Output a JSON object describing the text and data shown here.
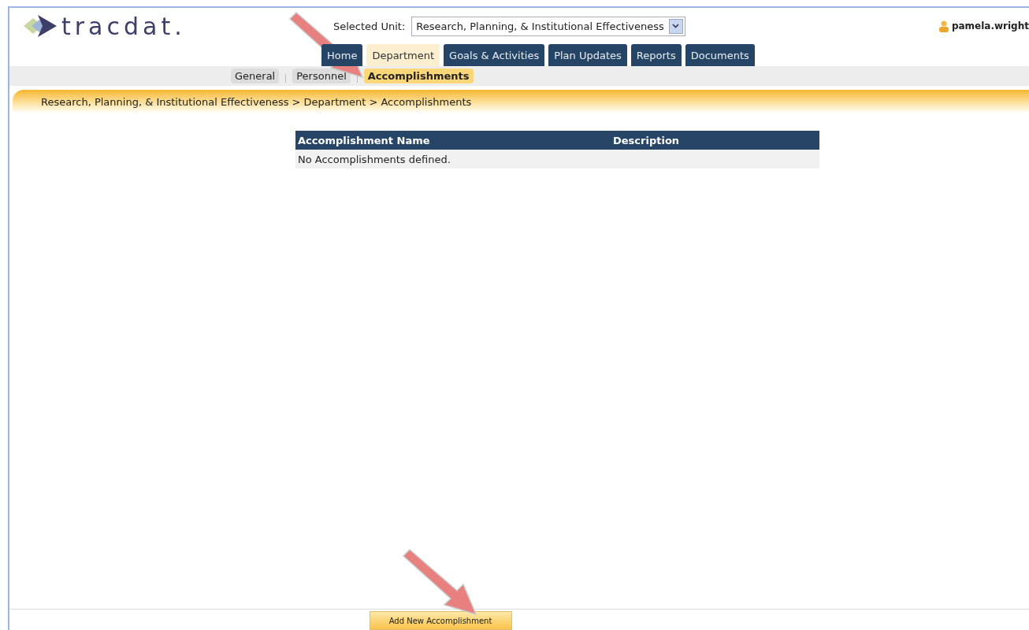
{
  "logo": {
    "text": "tracdat."
  },
  "unit_selector": {
    "label": "Selected Unit:",
    "value": "Research, Planning, & Institutional Effectiveness"
  },
  "user": {
    "name": "pamela.wright"
  },
  "tabs": [
    {
      "label": "Home",
      "selected": false
    },
    {
      "label": "Department",
      "selected": true
    },
    {
      "label": "Goals & Activities",
      "selected": false
    },
    {
      "label": "Plan Updates",
      "selected": false
    },
    {
      "label": "Reports",
      "selected": false
    },
    {
      "label": "Documents",
      "selected": false
    }
  ],
  "subtabs": [
    {
      "label": "General",
      "selected": false
    },
    {
      "label": "Personnel",
      "selected": false
    },
    {
      "label": "Accomplishments",
      "selected": true
    }
  ],
  "breadcrumb": "Research, Planning, & Institutional Effectiveness > Department > Accomplishments",
  "table": {
    "columns": [
      "Accomplishment Name",
      "Description"
    ],
    "empty_message": "No Accomplishments defined."
  },
  "add_button": "Add New Accomplishment"
}
